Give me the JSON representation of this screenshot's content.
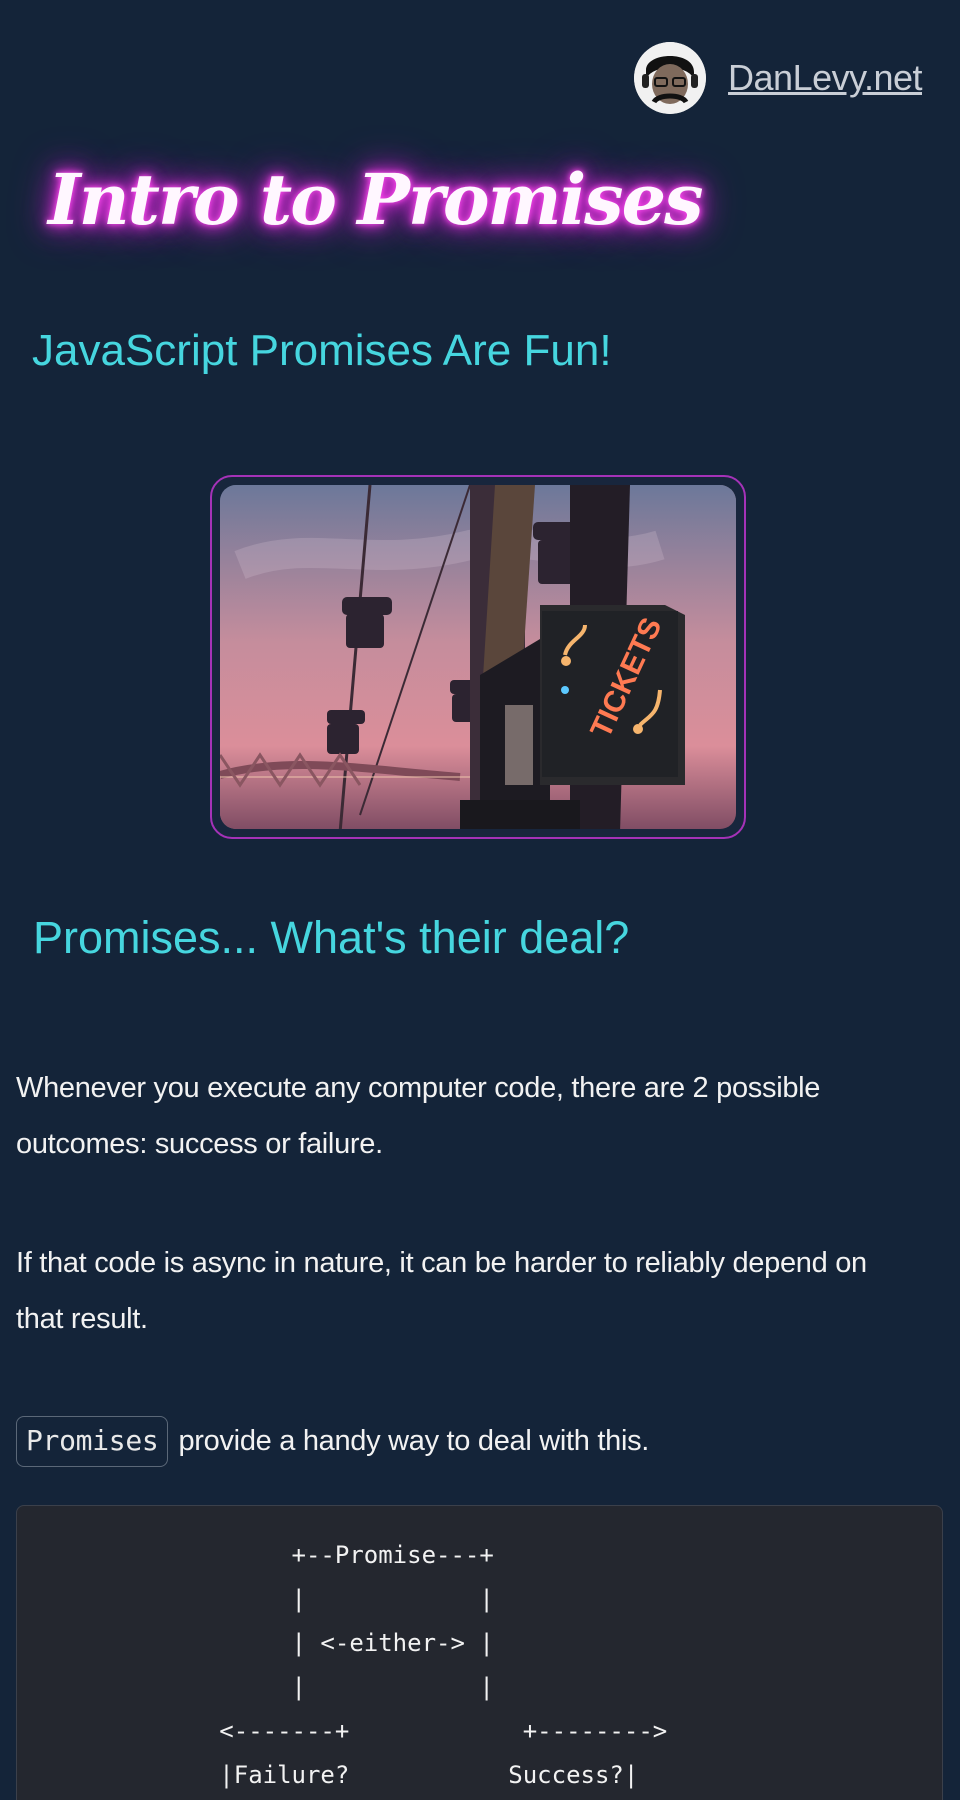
{
  "header": {
    "site_link": "DanLevy.net"
  },
  "hero": {
    "title": "Intro to Promises",
    "subtitle": "JavaScript Promises Are Fun!",
    "image": {
      "sign_text": "TICKETS"
    }
  },
  "section": {
    "heading": "Promises... What's their deal?",
    "paragraph_1": "Whenever you execute any computer code, there are 2 possible outcomes: success or failure.",
    "paragraph_2": "If that code is async in nature, it can be harder to reliably depend on that result.",
    "paragraph_3_code": "Promises",
    "paragraph_3_text": "provide a handy way to deal with this."
  },
  "code_block": {
    "lines": [
      "                   +--Promise---+",
      "                   |            |",
      "                   | <-either-> |",
      "                   |            |",
      "              <-------+            +-------->",
      "              |Failure?           Success?|"
    ]
  },
  "colors": {
    "background": "#142439",
    "accent_cyan": "#46d6df",
    "neon_pink": "#ff40ef",
    "frame_purple": "#a532b8",
    "code_bg": "#24272f"
  }
}
